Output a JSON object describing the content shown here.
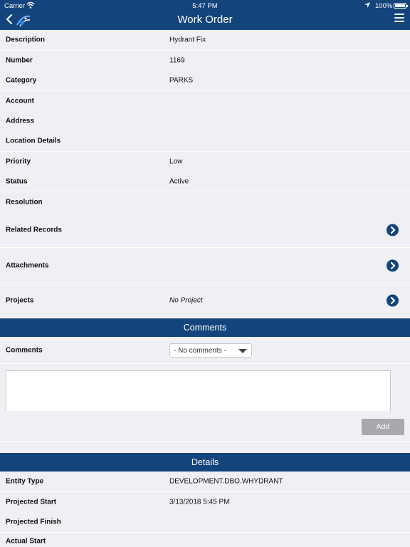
{
  "status_bar": {
    "carrier": "Carrier",
    "time": "5:47 PM",
    "battery": "100%"
  },
  "navbar": {
    "title": "Work Order"
  },
  "fields": [
    {
      "label": "Description",
      "value": "Hydrant Fix"
    },
    {
      "label": "Number",
      "value": "1169"
    },
    {
      "label": "Category",
      "value": "PARKS"
    },
    {
      "label": "Account",
      "value": ""
    },
    {
      "label": "Address",
      "value": ""
    },
    {
      "label": "Location Details",
      "value": ""
    },
    {
      "label": "Priority",
      "value": "Low"
    },
    {
      "label": "Status",
      "value": "Active"
    },
    {
      "label": "Resolution",
      "value": ""
    }
  ],
  "links": [
    {
      "label": "Related Records",
      "value": ""
    },
    {
      "label": "Attachments",
      "value": ""
    },
    {
      "label": "Projects",
      "value": "No Project"
    }
  ],
  "comments": {
    "section_title": "Comments",
    "label": "Comments",
    "selected": "- No comments -",
    "input_value": "",
    "add_label": "Add"
  },
  "details": {
    "section_title": "Details",
    "rows": [
      {
        "label": "Entity Type",
        "value": "DEVELOPMENT.DBO.WHYDRANT"
      },
      {
        "label": "Projected Start",
        "value": "3/13/2018 5:45 PM"
      },
      {
        "label": "Projected Finish",
        "value": ""
      },
      {
        "label": "Actual Start",
        "value": ""
      }
    ]
  },
  "icons": {
    "back": "chevron-left-icon",
    "logo": "app-logo-icon",
    "menu": "hamburger-menu-icon",
    "link_arrow": "chevron-right-circle-icon"
  },
  "colors": {
    "brand": "#13447c",
    "background": "#efeff4",
    "button_disabled": "#a8a8ad"
  }
}
